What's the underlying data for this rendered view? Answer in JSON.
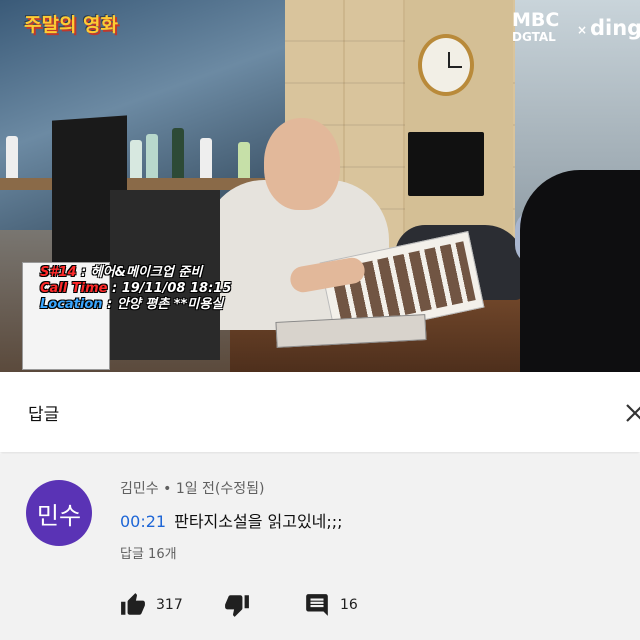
{
  "video": {
    "channel_logo": "주말의 영화",
    "broadcaster_main": "MBC",
    "broadcaster_sub": "DGTAL",
    "broadcaster_x": "×",
    "broadcaster_partner": "dinga",
    "scene_caption": {
      "scene_label": "S#14",
      "scene_value": " : 헤어&메이크업 준비",
      "calltime_label": "Call Time",
      "calltime_value": " : 19/11/08 18:15",
      "location_label": "Location",
      "location_value": " : 안양 평촌 **미용실"
    }
  },
  "replies_panel": {
    "title": "답글",
    "close_icon": "close-icon",
    "comment": {
      "avatar_text": "민수",
      "avatar_color": "#5a33b5",
      "author": "김민수",
      "separator": " • ",
      "time": "1일 전(수정됨)",
      "timestamp": "00:21",
      "text": "판타지소설을 읽고있네;;;",
      "reply_count": "답글 16개",
      "likes": "317",
      "replies": "16",
      "like_icon": "thumbs-up-icon",
      "dislike_icon": "thumbs-down-icon",
      "reply_icon": "comment-icon"
    }
  },
  "colors": {
    "link_blue": "#1e66d6",
    "caption_red": "#ff2a2a",
    "caption_blue": "#3ba7ff",
    "panel_bg": "#f2f2f2"
  }
}
